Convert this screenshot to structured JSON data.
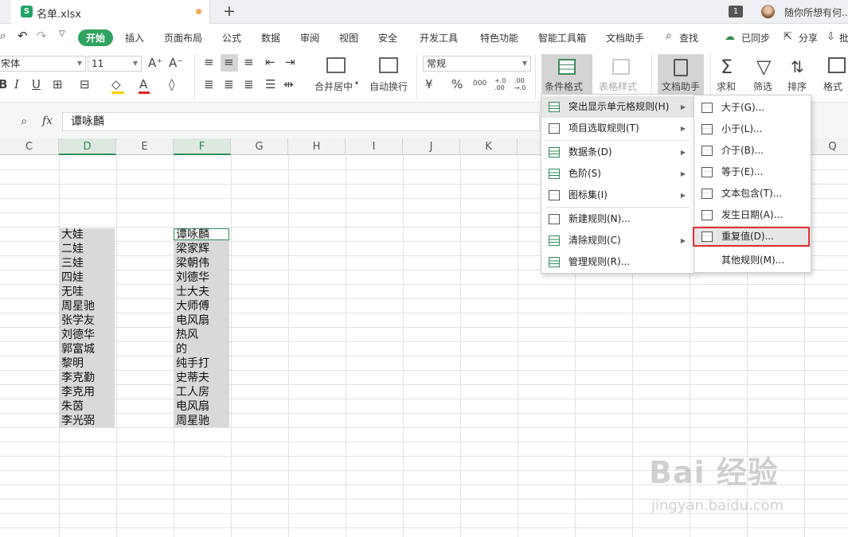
{
  "tabbar": {
    "file_icon": "S",
    "file_title": "名单.xlsx",
    "new_tab": "+",
    "badge": "1",
    "user_name": "随你所想有何..."
  },
  "menu": {
    "items": [
      "开始",
      "插入",
      "页面布局",
      "公式",
      "数据",
      "审阅",
      "视图",
      "安全",
      "开发工具",
      "特色功能",
      "智能工具箱",
      "文档助手"
    ],
    "search": "查找",
    "sync": "已同步",
    "share": "分享",
    "more": "批"
  },
  "toolbar": {
    "font_name": "宋体",
    "font_size": "11",
    "merge_center": "合并居中",
    "auto_wrap": "自动换行",
    "number_format": "常规",
    "cond_format": "条件格式",
    "table_style": "表格样式",
    "doc_helper": "文档助手",
    "sum": "求和",
    "filter": "筛选",
    "sort": "排序",
    "format": "格式",
    "percent": "%",
    "thousands": "000",
    "inc_decimal": "+.0\n.00",
    "dec_decimal": ".00\n→.0"
  },
  "formula": {
    "fx": "fx",
    "value": "谭咏麟"
  },
  "columns": [
    "C",
    "D",
    "E",
    "F",
    "G",
    "H",
    "I",
    "J",
    "K",
    "Q"
  ],
  "column_d": [
    "大娃",
    "二娃",
    "三娃",
    "四娃",
    "无哇",
    "周星驰",
    "张学友",
    "刘德华",
    "郭富城",
    "黎明",
    "李克勤",
    "李克用",
    "朱茵",
    "李光弼"
  ],
  "column_f": [
    "谭咏麟",
    "梁家辉",
    "梁朝伟",
    "刘德华",
    "士大夫",
    "大师傅",
    "电风扇",
    "热风",
    "的",
    "纯手打",
    "史蒂夫",
    "工人房",
    "电风扇",
    "周星驰"
  ],
  "cond_menu": [
    {
      "label": "突出显示单元格规则(H)",
      "submenu": true,
      "highlighted": true
    },
    {
      "label": "项目选取规则(T)",
      "submenu": true
    },
    {
      "label": "数据条(D)",
      "submenu": true
    },
    {
      "label": "色阶(S)",
      "submenu": true
    },
    {
      "label": "图标集(I)",
      "submenu": true
    },
    {
      "label": "新建规则(N)...",
      "submenu": false
    },
    {
      "label": "清除规则(C)",
      "submenu": true
    },
    {
      "label": "管理规则(R)...",
      "submenu": false
    }
  ],
  "highlight_menu": [
    "大于(G)...",
    "小于(L)...",
    "介于(B)...",
    "等于(E)...",
    "文本包含(T)...",
    "发生日期(A)...",
    "重复值(D)...",
    "其他规则(M)..."
  ],
  "watermark": {
    "main": "Bai 经验",
    "sub": "jingyan.baidu.com"
  },
  "colors": {
    "accent": "#2fa35f",
    "highlight_box": "#e03131"
  }
}
